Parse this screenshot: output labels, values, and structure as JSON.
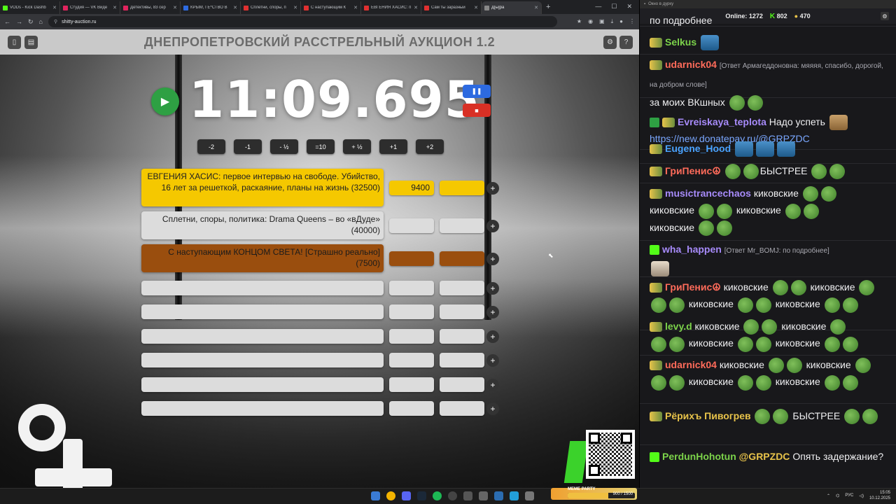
{
  "browser": {
    "tabs": [
      {
        "title": "VODs - Kick Dashb",
        "color": "#53fc18"
      },
      {
        "title": "Студия — VK Виде",
        "color": "#e0245e"
      },
      {
        "title": "Детективы, 83 сер",
        "color": "#e0245e"
      },
      {
        "title": "КРЫМ, ГЕ*СТВО В",
        "color": "#2d6ae0"
      },
      {
        "title": "Сплетни, споры, п",
        "color": "#e03030"
      },
      {
        "title": "С наступающим К",
        "color": "#e03030"
      },
      {
        "title": "ЕВГЕНИЯ ХАСИС: п",
        "color": "#e03030"
      },
      {
        "title": "Сам ты заразный",
        "color": "#e03030"
      },
      {
        "title": "Д[ы]ра",
        "color": "#888888"
      }
    ],
    "url": "shitty-auction.ru"
  },
  "auction": {
    "title": "ДНЕПРОПЕТРОВСКИЙ РАССТРЕЛЬНЫЙ АУКЦИОН 1.2",
    "timer": "11:09.695",
    "adjust_buttons": [
      "-2",
      "-1",
      "- ½",
      "=10",
      "+ ½",
      "+1",
      "+2"
    ],
    "lots": [
      {
        "name": "ЕВГЕНИЯ ХАСИС: первое интервью на свободе. Убийство, 16 лет за решеткой, раскаяние, планы на жизнь (32500)",
        "amount": "9400",
        "style": "yellow"
      },
      {
        "name": "Сплетни, споры, политика: Drama Queens – во «вДуде» (40000)",
        "amount": "",
        "style": "gray"
      },
      {
        "name": "С наступающим КОНЦОМ СВЕТА! [Страшно реально] (7500)",
        "amount": "",
        "style": "brown"
      },
      {
        "name": "",
        "amount": "",
        "style": "gray"
      },
      {
        "name": "",
        "amount": "",
        "style": "gray"
      },
      {
        "name": "",
        "amount": "",
        "style": "gray"
      },
      {
        "name": "",
        "amount": "",
        "style": "gray"
      },
      {
        "name": "",
        "amount": "",
        "style": "gray"
      },
      {
        "name": "",
        "amount": "",
        "style": "gray"
      }
    ]
  },
  "chat": {
    "window_title": "Окно в дурку",
    "online_label": "Online:",
    "online_count": "1272",
    "kick_count": "802",
    "coin_count": "470",
    "partial_top": "по подробнее",
    "messages": [
      {
        "user": "Selkus",
        "color": "#7cd34a",
        "text": ""
      },
      {
        "user": "udarnick04",
        "color": "#ff6b5a",
        "reply": "[Ответ Армагеддоновна: мяяяя, спасибо, дорогой, на добром слове]",
        "text": "за моих ВКшных"
      },
      {
        "user": "Evreiskaya_teplota",
        "color": "#a78bfa",
        "text": "Надо успеть",
        "link": "https://new.donatepay.ru/@GRPZDC"
      },
      {
        "user": "Eugene_Hood",
        "color": "#4aa3ff",
        "text": ""
      },
      {
        "user": "ГриПенис☮",
        "color": "#ff6b5a",
        "text": "БЫСТРЕЕ"
      },
      {
        "user": "musictrancechaos",
        "color": "#a78bfa",
        "text": "киковские",
        "line2a": "киковские",
        "line2b": "киковские",
        "line3": "киковские"
      },
      {
        "user": "wha_happen",
        "color": "#a78bfa",
        "reply": "[Ответ Mr_BOMJ: по подробнее]",
        "text": ""
      },
      {
        "user": "ГриПенис☮",
        "color": "#ff6b5a",
        "text": "киковские",
        "text2": "киковские",
        "line2a": "киковские",
        "line2b": "киковские"
      },
      {
        "user": "levy.d",
        "color": "#7cd34a",
        "text": "киковские",
        "text2": "киковские",
        "line2a": "киковские",
        "line2b": "киковские"
      },
      {
        "user": "udarnick04",
        "color": "#ff6b5a",
        "text": "киковские",
        "text2": "киковские",
        "line2a": "киковские",
        "line2b": "киковские"
      },
      {
        "user": "Рёрихъ Пивогрев",
        "color": "#e8c34a",
        "text": "БЫСТРЕЕ"
      },
      {
        "user": "PerdunHohotun",
        "color": "#7cd34a",
        "mention": "@GRPZDC",
        "text": "Опять задержание?"
      }
    ]
  },
  "taskbar": {
    "widget_label": "MEME PARTY",
    "widget_count": "900 / 1500",
    "widget_progress": 0.6,
    "lang": "РУС",
    "time": "15:05",
    "date": "10.12.2025"
  }
}
